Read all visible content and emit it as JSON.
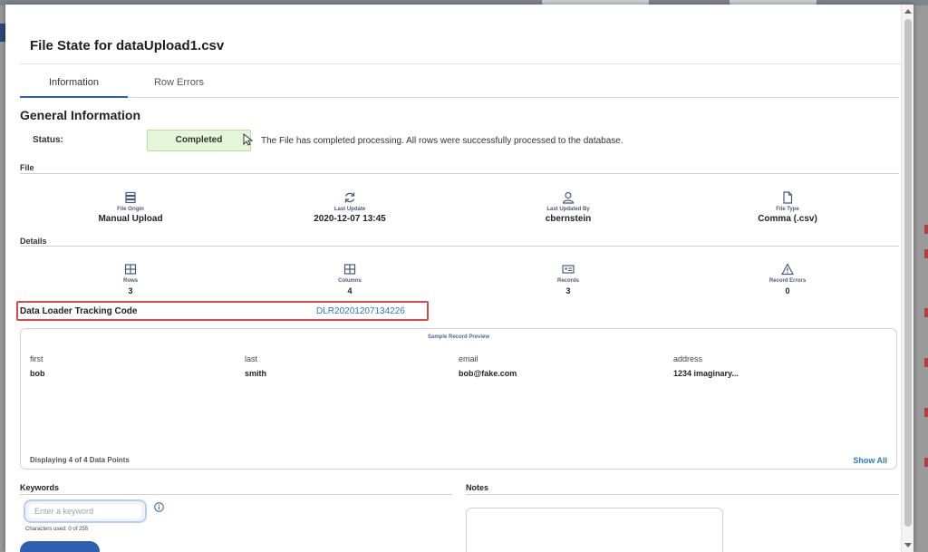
{
  "modal": {
    "title": "File State for dataUpload1.csv"
  },
  "tabs": [
    {
      "label": "Information",
      "active": true
    },
    {
      "label": "Row Errors",
      "active": false
    }
  ],
  "general": {
    "heading": "General Information",
    "status_label": "Status:",
    "status_value": "Completed",
    "status_message": "The File has completed processing. All rows were successfully processed to the database."
  },
  "file_section": {
    "label": "File",
    "items": [
      {
        "icon": "server-icon",
        "label": "File Origin",
        "value": "Manual Upload"
      },
      {
        "icon": "refresh-icon",
        "label": "Last Update",
        "value": "2020-12-07 13:45"
      },
      {
        "icon": "user-icon",
        "label": "Last Updated By",
        "value": "cbernstein"
      },
      {
        "icon": "file-icon",
        "label": "File Type",
        "value": "Comma (.csv)"
      }
    ]
  },
  "details_section": {
    "label": "Details",
    "items": [
      {
        "icon": "table-icon",
        "label": "Rows",
        "value": "3"
      },
      {
        "icon": "table-icon",
        "label": "Columns",
        "value": "4"
      },
      {
        "icon": "id-card-icon",
        "label": "Records",
        "value": "3"
      },
      {
        "icon": "warning-icon",
        "label": "Record Errors",
        "value": "0"
      }
    ]
  },
  "tracking": {
    "label": "Data Loader Tracking Code",
    "value": "DLR20201207134226"
  },
  "preview": {
    "title": "Sample Record Preview",
    "columns": [
      {
        "header": "first",
        "value": "bob"
      },
      {
        "header": "last",
        "value": "smith"
      },
      {
        "header": "email",
        "value": "bob@fake.com"
      },
      {
        "header": "address",
        "value": "1234 imaginary..."
      }
    ],
    "count_text": "Displaying 4 of 4 Data Points",
    "show_all_label": "Show All"
  },
  "keywords": {
    "label": "Keywords",
    "placeholder": "Enter a keyword",
    "chars_used": "Characters used: 0 of 255"
  },
  "notes": {
    "label": "Notes"
  },
  "colors": {
    "accent": "#2f5fb0",
    "link": "#2d78c4",
    "status_bg": "#e6f6d9",
    "highlight_border": "#d94a4a"
  }
}
